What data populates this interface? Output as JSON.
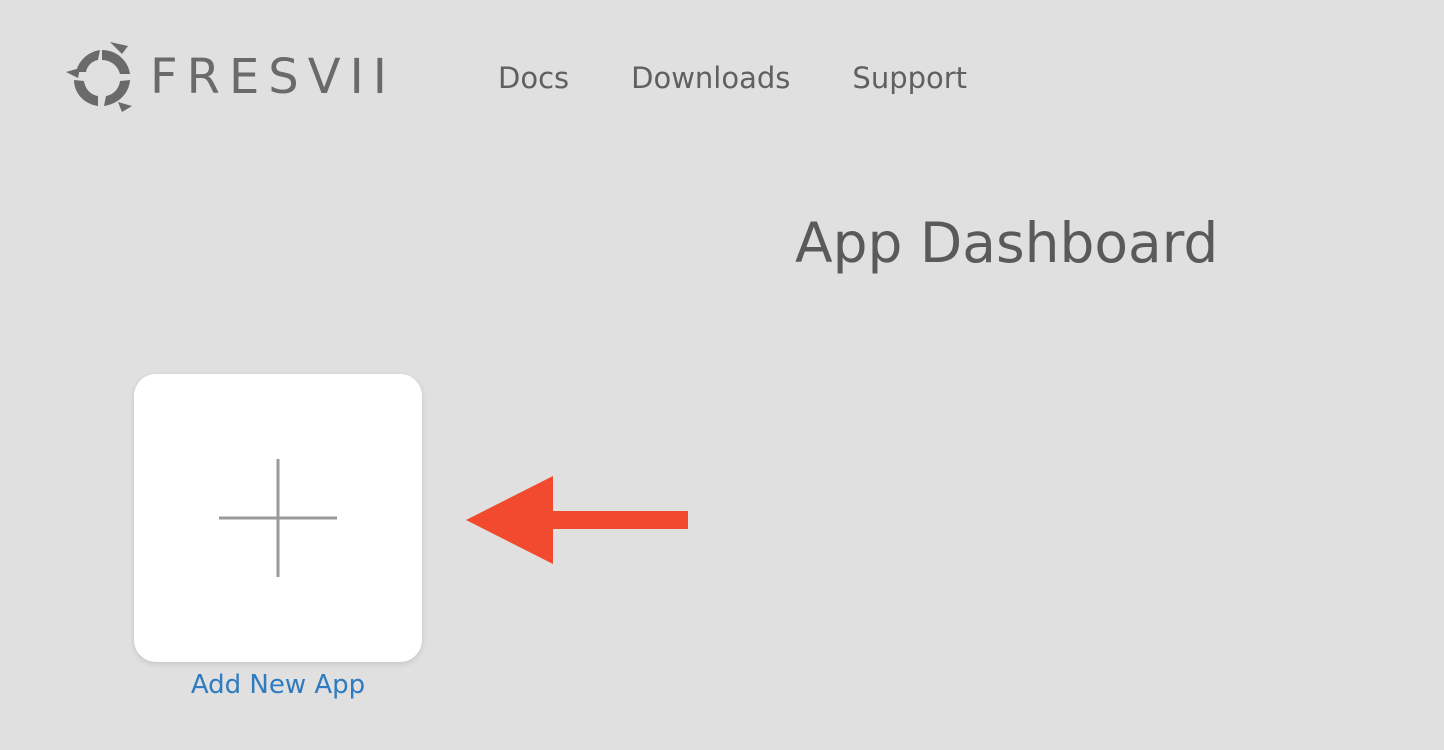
{
  "header": {
    "brand": "FRESVII",
    "logo_icon": "fresvii-emblem-icon",
    "nav": [
      {
        "label": "Docs"
      },
      {
        "label": "Downloads"
      },
      {
        "label": "Support"
      }
    ]
  },
  "main": {
    "title": "App Dashboard",
    "add_app": {
      "icon": "plus-icon",
      "label": "Add New App"
    }
  },
  "annotation": {
    "icon": "arrow-left-icon",
    "color": "#f24a2e"
  },
  "colors": {
    "background": "#e0e0e0",
    "link": "#2e7bbf",
    "text": "#5f5f5f"
  }
}
